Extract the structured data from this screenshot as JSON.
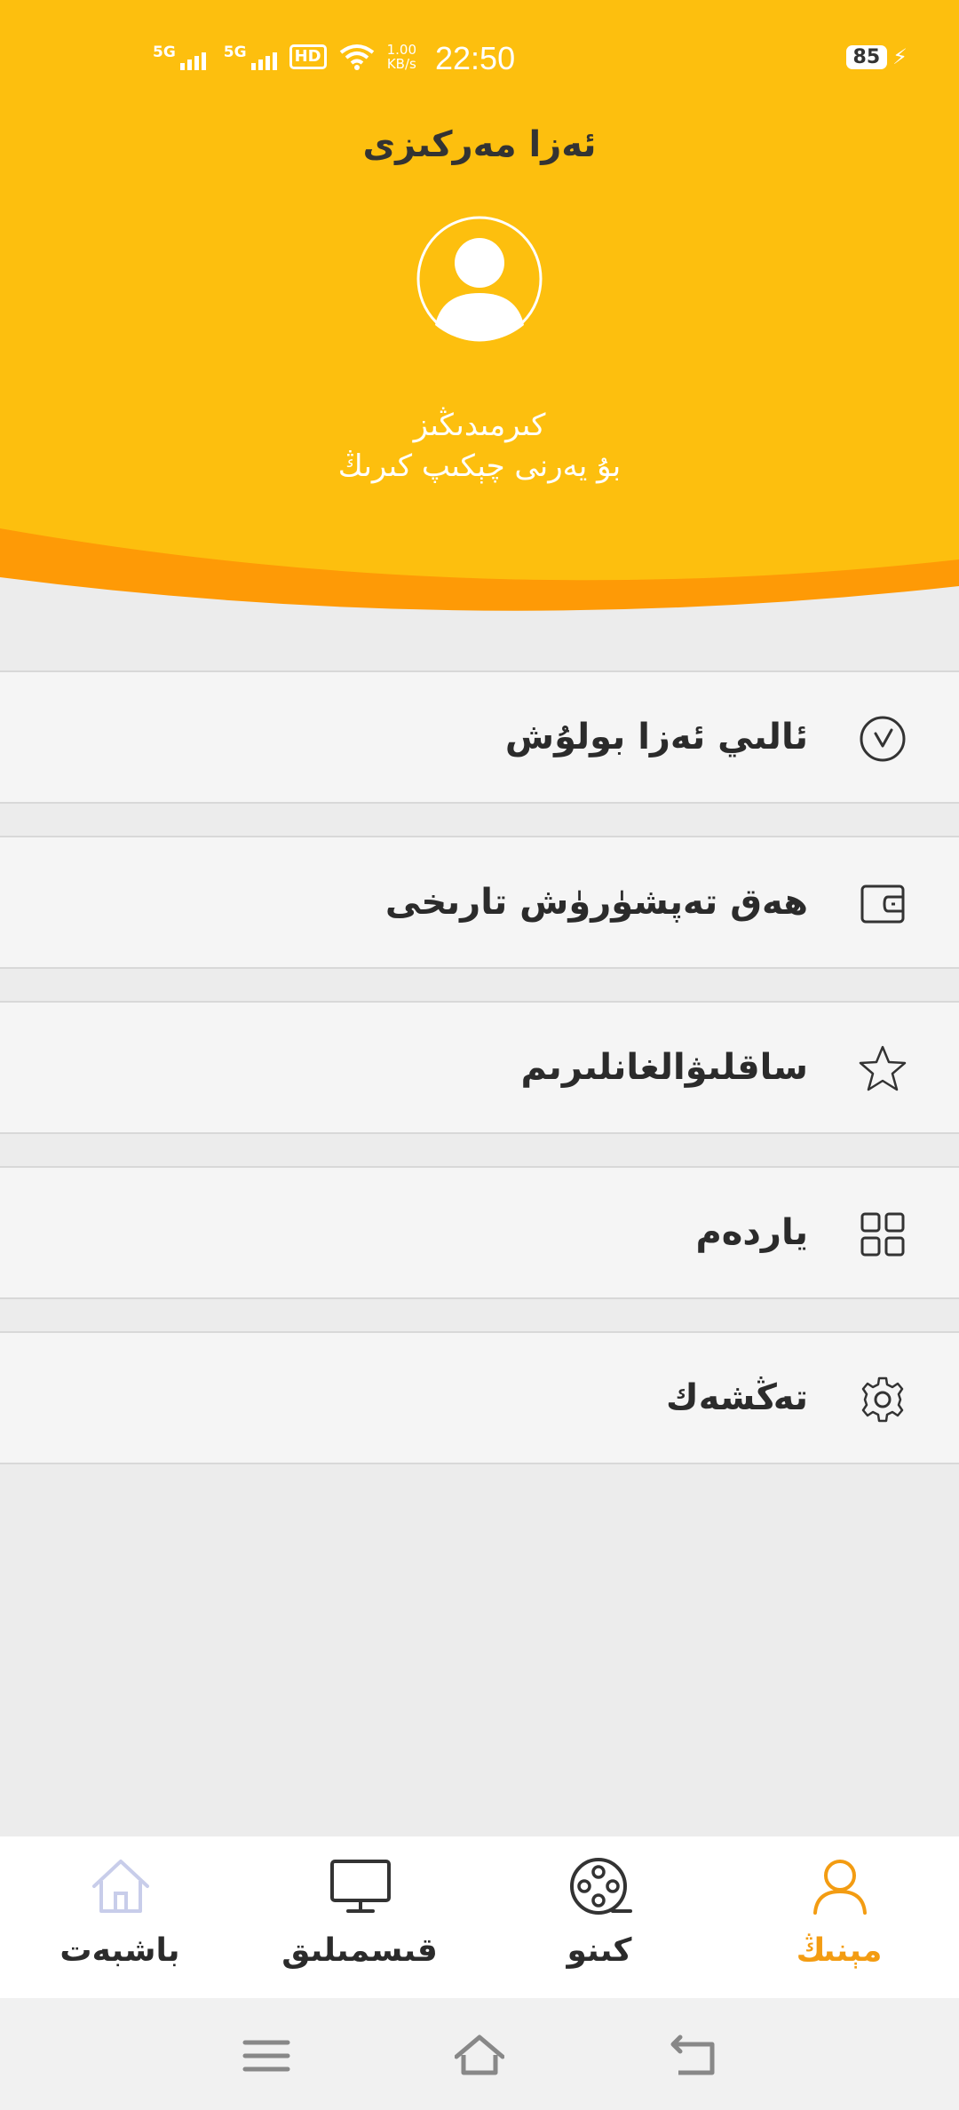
{
  "status_bar": {
    "signal1": "5G",
    "signal2": "5G",
    "hd": "HD",
    "net_speed_value": "1.00",
    "net_speed_unit": "KB/s",
    "time": "22:50",
    "battery": "85"
  },
  "header": {
    "title": "ئەزا مەركىزى",
    "login_line1": "كىرمىدىڭىز",
    "login_line2": "بۇ يەرنى چېكىپ كىرىڭ"
  },
  "menu": {
    "items": [
      {
        "label": "ئالىي ئەزا بولۇش",
        "icon": "vip-badge-icon"
      },
      {
        "label": "ھەق تەپشۈرۈش تارىخى",
        "icon": "wallet-icon"
      },
      {
        "label": "ساقلىۋالغانلىرىم",
        "icon": "star-icon"
      },
      {
        "label": "ياردەم",
        "icon": "grid-icon"
      },
      {
        "label": "تەڭشەك",
        "icon": "gear-icon"
      }
    ]
  },
  "bottom_nav": {
    "items": [
      {
        "label": "باشبەت",
        "icon": "home-icon"
      },
      {
        "label": "قىسمىلىق",
        "icon": "tv-icon"
      },
      {
        "label": "كىنو",
        "icon": "film-reel-icon"
      },
      {
        "label": "مېنىڭ",
        "icon": "user-icon",
        "active": true
      }
    ]
  },
  "colors": {
    "header_yellow": "#fdbf0e",
    "header_orange": "#fe9a06",
    "active_tab": "#f39c12",
    "inactive_home": "#c8cdea"
  }
}
